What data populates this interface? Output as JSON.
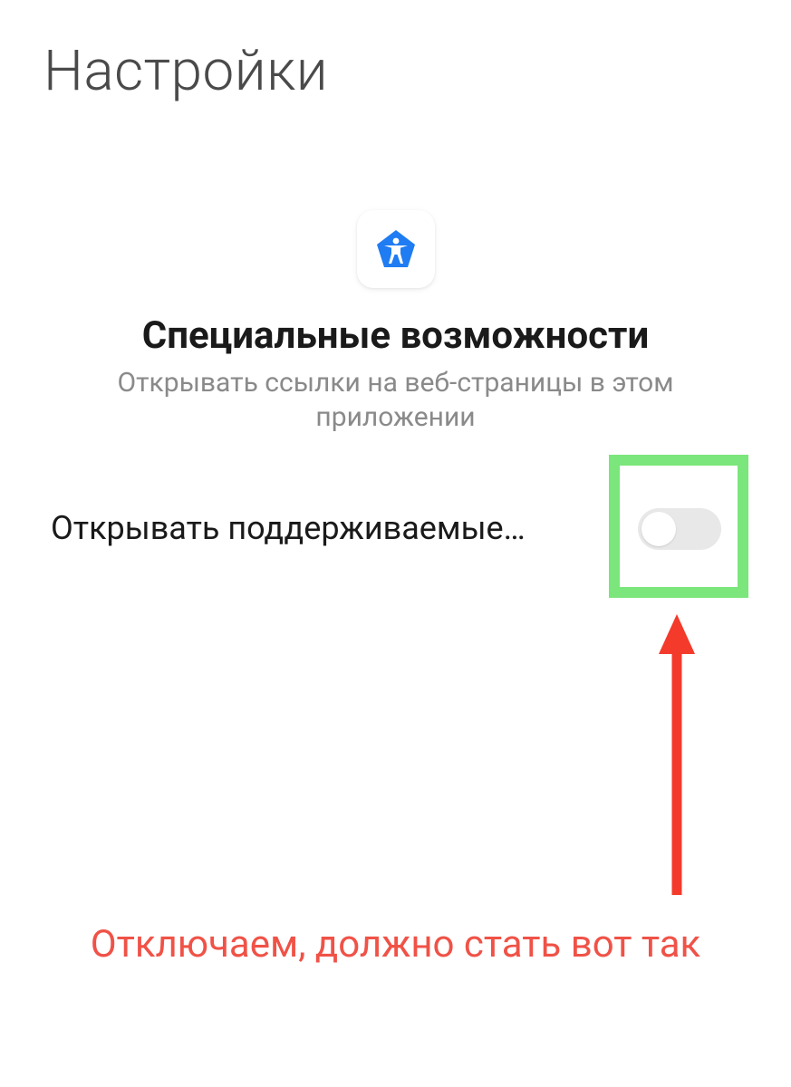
{
  "header": {
    "title": "Настройки"
  },
  "app": {
    "icon_name": "accessibility-icon",
    "section_title": "Специальные возможности",
    "section_subtitle": "Открывать ссылки на веб-страницы в этом приложении"
  },
  "setting": {
    "label": "Открывать поддерживаемые…",
    "toggle_state": "off"
  },
  "annotation": {
    "highlight_color": "#7be67b",
    "arrow_color": "#f33a2b",
    "text": "Отключаем, должно стать вот так",
    "text_color": "#f05247"
  }
}
